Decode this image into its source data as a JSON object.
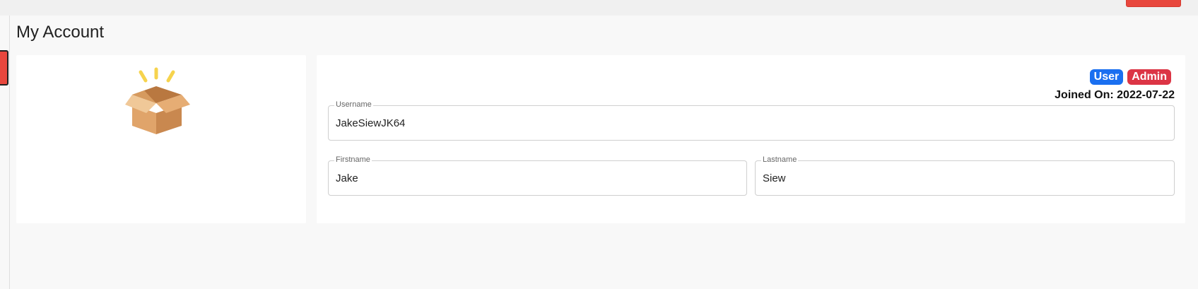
{
  "page": {
    "title": "My Account"
  },
  "profile": {
    "avatar_icon": "open-box-icon",
    "roles": [
      "User",
      "Admin"
    ],
    "joined_label": "Joined On: 2022-07-22"
  },
  "form": {
    "username": {
      "label": "Username",
      "value": "JakeSiewJK64"
    },
    "firstname": {
      "label": "Firstname",
      "value": "Jake"
    },
    "lastname": {
      "label": "Lastname",
      "value": "Siew"
    }
  },
  "colors": {
    "accent_red": "#e8473d",
    "badge_user": "#1a6ff0",
    "badge_admin": "#dc3545"
  }
}
